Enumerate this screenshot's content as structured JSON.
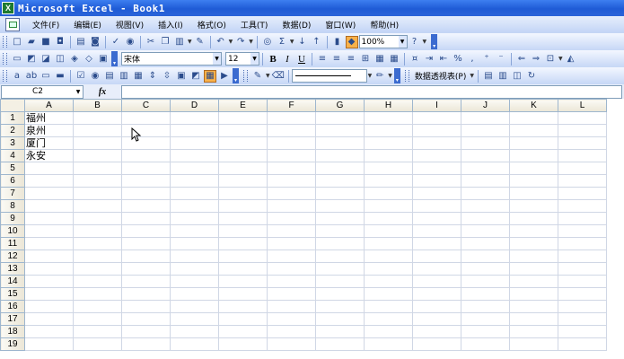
{
  "window": {
    "title": "Microsoft Excel - Book1",
    "app_icon": "X"
  },
  "menu": {
    "items": [
      {
        "label": "文件(F)"
      },
      {
        "label": "编辑(E)"
      },
      {
        "label": "视图(V)"
      },
      {
        "label": "插入(I)"
      },
      {
        "label": "格式(O)"
      },
      {
        "label": "工具(T)"
      },
      {
        "label": "数据(D)"
      },
      {
        "label": "窗口(W)"
      },
      {
        "label": "帮助(H)"
      }
    ]
  },
  "standard_toolbar": {
    "zoom": "100%"
  },
  "formatting_toolbar": {
    "font": "宋体",
    "size": "12",
    "bold": "B",
    "italic": "I",
    "underline": "U",
    "percent": "%",
    "comma": ","
  },
  "drawing_toolbar": {
    "pivot_label": "数据透视表(P)"
  },
  "formula_bar": {
    "name_box": "C2",
    "fx": "fx",
    "formula": ""
  },
  "sheet": {
    "columns": [
      "A",
      "B",
      "C",
      "D",
      "E",
      "F",
      "G",
      "H",
      "I",
      "J",
      "K",
      "L"
    ],
    "rows": [
      {
        "num": "1",
        "A": "福州"
      },
      {
        "num": "2",
        "A": "泉州"
      },
      {
        "num": "3",
        "A": "厦门"
      },
      {
        "num": "4",
        "A": "永安"
      },
      {
        "num": "5",
        "A": ""
      },
      {
        "num": "6",
        "A": ""
      },
      {
        "num": "7",
        "A": ""
      },
      {
        "num": "8",
        "A": ""
      },
      {
        "num": "9",
        "A": ""
      },
      {
        "num": "10",
        "A": ""
      },
      {
        "num": "11",
        "A": ""
      },
      {
        "num": "12",
        "A": ""
      },
      {
        "num": "13",
        "A": ""
      },
      {
        "num": "14",
        "A": ""
      },
      {
        "num": "15",
        "A": ""
      },
      {
        "num": "16",
        "A": ""
      },
      {
        "num": "17",
        "A": ""
      },
      {
        "num": "18",
        "A": ""
      },
      {
        "num": "19",
        "A": ""
      }
    ]
  },
  "colors": {
    "title_bar": "#2a63d8",
    "toolbar": "#c6d7f6",
    "grid_line": "#d0d7e5",
    "active_button": "#f8b14a"
  }
}
